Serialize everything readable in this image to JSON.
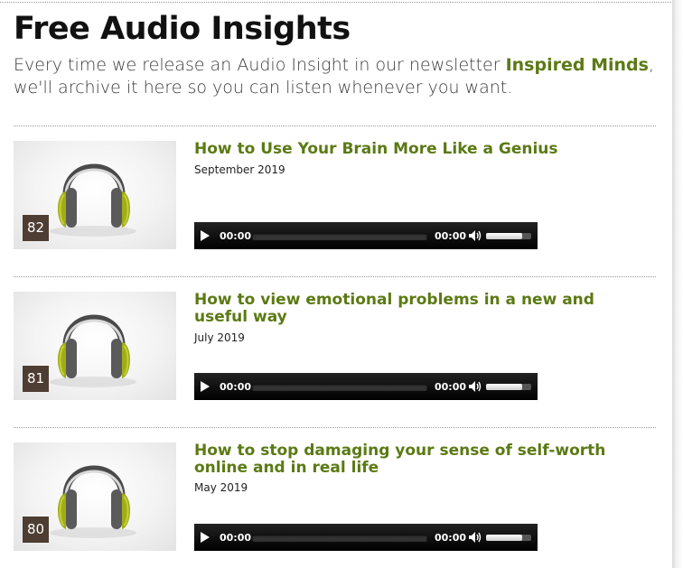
{
  "page": {
    "title": "Free Audio Insights",
    "intro_before": "Every time we release an Audio Insight in our newsletter ",
    "intro_brand": "Inspired Minds",
    "intro_after": ", we'll archive it here so you can listen whenever you want."
  },
  "colors": {
    "accent_green": "#5b7a14",
    "badge_brown": "#4e3d32",
    "player_bg": "#000000"
  },
  "items": [
    {
      "number": "82",
      "title": "How to Use Your Brain More Like a Genius",
      "date": "September 2019",
      "current_time": "00:00",
      "duration": "00:00",
      "volume": 0.8,
      "thumbnail_icon": "headphones-icon"
    },
    {
      "number": "81",
      "title": "How to view emotional problems in a new and useful way",
      "date": "July 2019",
      "current_time": "00:00",
      "duration": "00:00",
      "volume": 0.8,
      "thumbnail_icon": "headphones-icon"
    },
    {
      "number": "80",
      "title": "How to stop damaging your sense of self-worth online and in real life",
      "date": "May 2019",
      "current_time": "00:00",
      "duration": "00:00",
      "volume": 0.8,
      "thumbnail_icon": "headphones-icon"
    }
  ]
}
